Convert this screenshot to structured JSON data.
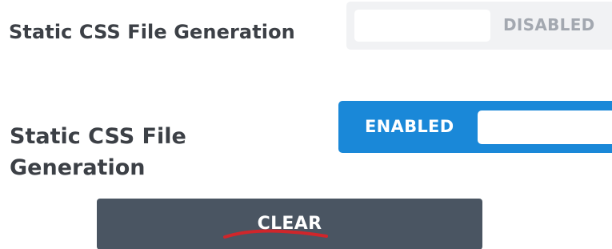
{
  "settings": [
    {
      "label": "Static CSS File Generation",
      "toggle_state": "DISABLED",
      "enabled": false
    },
    {
      "label": "Static CSS File Generation",
      "toggle_state": "ENABLED",
      "enabled": true
    }
  ],
  "clear_button": {
    "label": "CLEAR"
  },
  "colors": {
    "label_text": "#3c4046",
    "toggle_off_bg": "#f1f2f4",
    "toggle_off_text": "#a3a8b0",
    "toggle_on_bg": "#1a88d8",
    "clear_bg": "#4a5562",
    "underline_mark": "#d0262b"
  }
}
